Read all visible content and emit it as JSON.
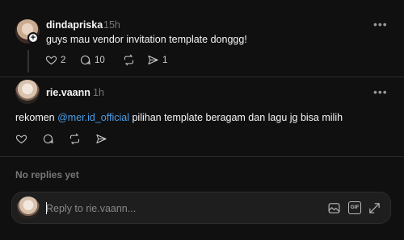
{
  "post": {
    "username": "dindapriska",
    "time": "15h",
    "text": "guys mau vendor invitation template donggg!",
    "likes": "2",
    "comments": "10",
    "shares": "1"
  },
  "reply": {
    "username": "rie.vaann",
    "time": "1h",
    "text_before": "rekomen ",
    "mention": "@mer.id_official",
    "text_after": " pilihan template beragam dan lagu jg bisa milih"
  },
  "no_replies": "No replies yet",
  "composer": {
    "placeholder": "Reply to rie.vaann..."
  },
  "icons": {
    "more": "more-icon",
    "like": "heart-icon",
    "comment": "comment-icon",
    "repost": "repost-icon",
    "share": "send-icon",
    "image": "image-icon",
    "gif": "gif-icon",
    "expand": "expand-icon"
  },
  "colors": {
    "background": "#101010",
    "mention": "#4a9eea",
    "muted": "#777777"
  }
}
